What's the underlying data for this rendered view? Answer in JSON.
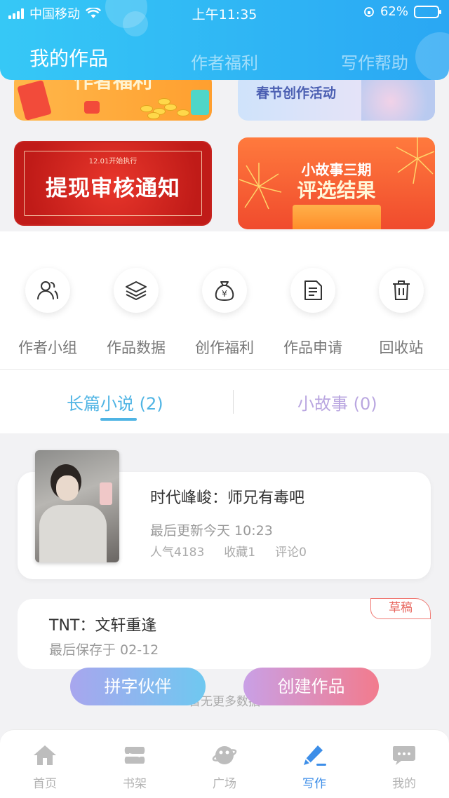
{
  "status_bar": {
    "carrier": "中国移动",
    "time": "上午11:35",
    "battery": "62%"
  },
  "top_tabs": [
    {
      "label": "我的作品",
      "active": true
    },
    {
      "label": "作者福利",
      "active": false
    },
    {
      "label": "写作帮助",
      "active": false
    }
  ],
  "banners": {
    "author_welfare": "作者福利",
    "spring_activity": "春节创作活动",
    "withdraw_small": "12.01开始执行",
    "withdraw_notice": "提现审核通知",
    "story_period": "小故事三期",
    "selection_result": "评选结果"
  },
  "quick_actions": [
    {
      "label": "作者小组",
      "icon": "group-icon"
    },
    {
      "label": "作品数据",
      "icon": "layers-icon"
    },
    {
      "label": "创作福利",
      "icon": "money-bag-icon"
    },
    {
      "label": "作品申请",
      "icon": "document-icon"
    },
    {
      "label": "回收站",
      "icon": "trash-icon"
    }
  ],
  "sub_tabs": [
    {
      "label": "长篇小说 (2)",
      "active": true
    },
    {
      "label": "小故事 (0)",
      "active": false
    }
  ],
  "book": {
    "title": "时代峰峻：师兄有毒吧",
    "updated": "最后更新今天 10:23",
    "popularity": "人气4183",
    "favorites": "收藏1",
    "comments": "评论0"
  },
  "draft": {
    "title": "TNT：文轩重逢",
    "saved": "最后保存于 02-12",
    "badge": "草稿"
  },
  "no_more": "暂无更多数据",
  "buttons": {
    "partner": "拼字伙伴",
    "create": "创建作品"
  },
  "bottom_nav": [
    {
      "label": "首页",
      "icon": "home-icon",
      "active": false
    },
    {
      "label": "书架",
      "icon": "bookshelf-icon",
      "active": false
    },
    {
      "label": "广场",
      "icon": "planet-icon",
      "active": false
    },
    {
      "label": "写作",
      "icon": "pen-icon",
      "active": true
    },
    {
      "label": "我的",
      "icon": "chat-icon",
      "active": false
    }
  ],
  "colors": {
    "header": "#2aa7f3",
    "accent_blue": "#4fb4e4",
    "nav_active": "#3d8ee8",
    "draft_badge": "#e86860"
  }
}
